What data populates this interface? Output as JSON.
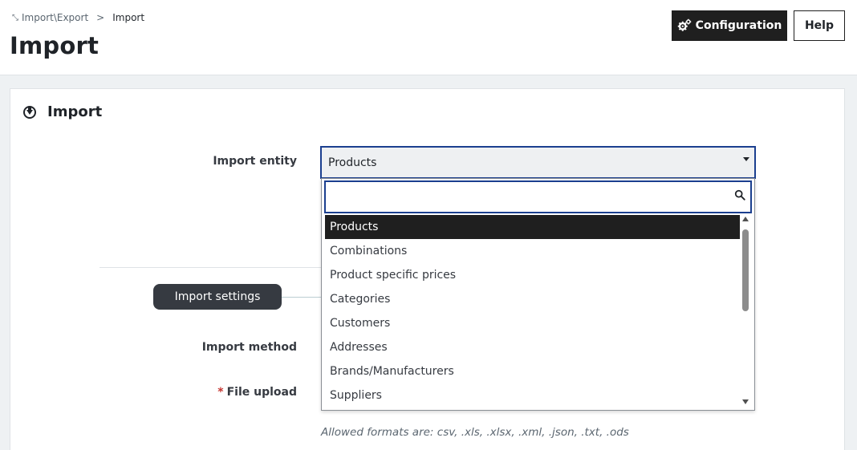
{
  "breadcrumb": {
    "parent": "Import\\Export",
    "separator": ">",
    "current": "Import"
  },
  "page": {
    "title": "Import"
  },
  "toolbar": {
    "configuration_label": "Configuration",
    "help_label": "Help"
  },
  "card": {
    "title": "Import"
  },
  "form": {
    "entity_label": "Import entity",
    "entity_value": "Products",
    "settings_pill": "Import settings",
    "method_label": "Import method",
    "file_required_mark": "*",
    "file_label": "File upload",
    "allowed_formats": "Allowed formats are: csv, .xls, .xlsx, .xml, .json, .txt, .ods"
  },
  "dropdown": {
    "search_value": "",
    "options": [
      "Products",
      "Combinations",
      "Product specific prices",
      "Categories",
      "Customers",
      "Addresses",
      "Brands/Manufacturers",
      "Suppliers"
    ],
    "selected": "Products"
  },
  "icons": {
    "config": "gears-icon",
    "search": "search-icon",
    "card": "circle-arrow-down-icon"
  },
  "colors": {
    "primary_dark": "#1f1f1f",
    "focus_border": "#1b3f8f",
    "required": "#c5342f",
    "pill": "#363a41"
  }
}
